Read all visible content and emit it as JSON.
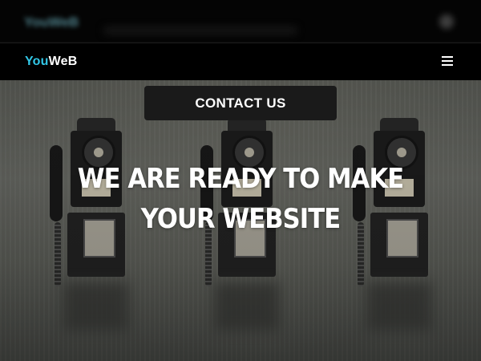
{
  "ghost": {
    "logo": "YouWeB"
  },
  "nav": {
    "brand_part1": "You",
    "brand_part2": "WeB",
    "menu_icon": "hamburger-menu-icon"
  },
  "hero": {
    "contact_label": "CONTACT US",
    "headline": "WE ARE READY TO MAKE YOUR WEBSITE"
  },
  "colors": {
    "brand_accent": "#32c6e6",
    "navbar_bg": "#000000",
    "button_bg": "#1a1a1a"
  }
}
